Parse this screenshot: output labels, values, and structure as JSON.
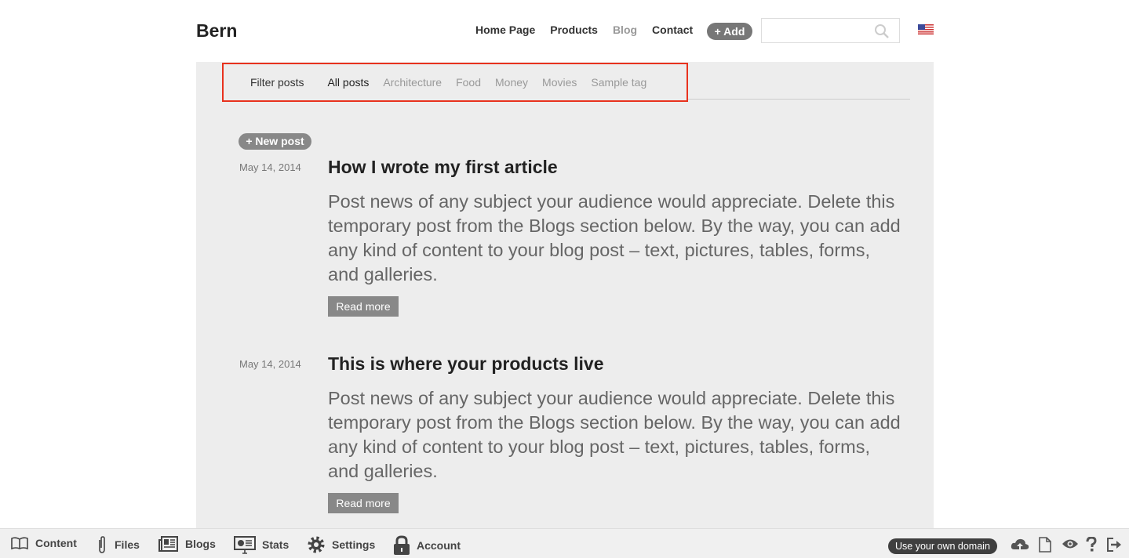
{
  "header": {
    "logo": "Bern",
    "nav": [
      "Home Page",
      "Products",
      "Blog",
      "Contact"
    ],
    "active_nav": "Blog",
    "add_label": "+ Add",
    "search_placeholder": "",
    "language": "en-US"
  },
  "filter": {
    "label": "Filter posts",
    "tags": [
      "All posts",
      "Architecture",
      "Food",
      "Money",
      "Movies",
      "Sample tag"
    ],
    "selected": "All posts",
    "highlight_color": "#e8321e"
  },
  "new_post_label": "+ New post",
  "posts": [
    {
      "date": "May 14, 2014",
      "title": "How I wrote my first article",
      "body": "Post news of any subject your audience would appreciate. Delete this temporary post from the Blogs section below. By the way, you can add any kind of content to your blog post – text, pictures, tables, forms, and galleries.",
      "read_more": "Read more"
    },
    {
      "date": "May 14, 2014",
      "title": "This is where your products live",
      "body": "Post news of any subject your audience would appreciate. Delete this temporary post from the Blogs section below. By the way, you can add any kind of content to your blog post – text, pictures, tables, forms, and galleries.",
      "read_more": "Read more"
    }
  ],
  "toolbar": {
    "items": [
      {
        "label": "Content",
        "icon": "book-icon"
      },
      {
        "label": "Files",
        "icon": "paperclip-icon"
      },
      {
        "label": "Blogs",
        "icon": "newspaper-icon"
      },
      {
        "label": "Stats",
        "icon": "presentation-icon"
      },
      {
        "label": "Settings",
        "icon": "gear-icon"
      },
      {
        "label": "Account",
        "icon": "lock-icon"
      }
    ],
    "domain_label": "Use your own domain",
    "right_icons": [
      "cloud-upload-icon",
      "page-icon",
      "eye-icon",
      "help-icon",
      "logout-icon"
    ]
  }
}
